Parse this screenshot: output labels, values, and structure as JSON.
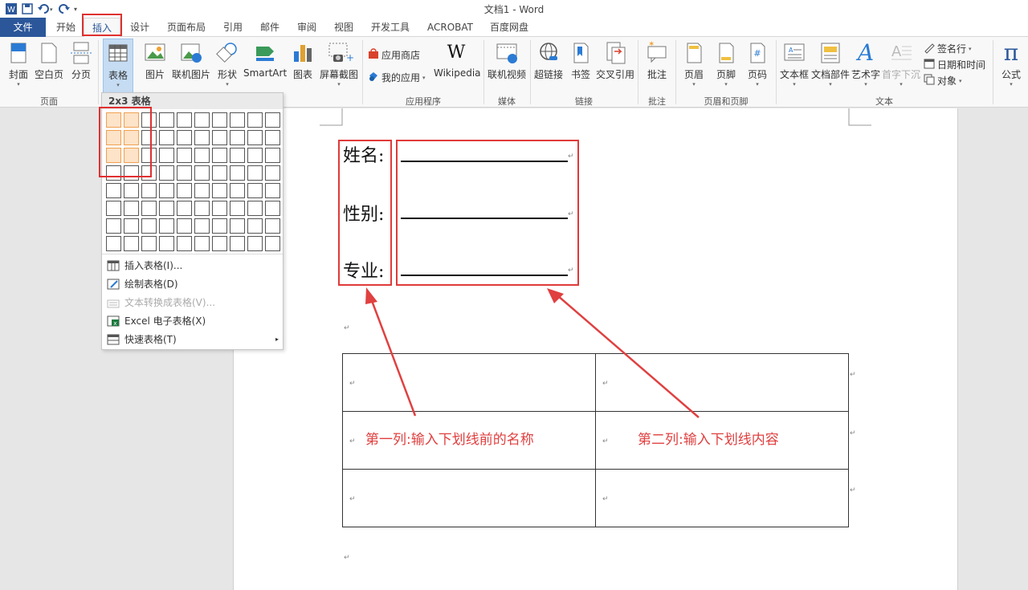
{
  "titlebar": {
    "doc_title": "文档1 - Word"
  },
  "tabs": [
    {
      "label": "文件"
    },
    {
      "label": "开始"
    },
    {
      "label": "插入"
    },
    {
      "label": "设计"
    },
    {
      "label": "页面布局"
    },
    {
      "label": "引用"
    },
    {
      "label": "邮件"
    },
    {
      "label": "审阅"
    },
    {
      "label": "视图"
    },
    {
      "label": "开发工具"
    },
    {
      "label": "ACROBAT"
    },
    {
      "label": "百度网盘"
    }
  ],
  "ribbon": {
    "buttons": {
      "cover": "封面",
      "blank": "空白页",
      "pagebreak": "分页",
      "table": "表格",
      "picture": "图片",
      "online_picture": "联机图片",
      "shapes": "形状",
      "smartart": "SmartArt",
      "chart": "图表",
      "screenshot": "屏幕截图",
      "app_store": "应用商店",
      "my_apps": "我的应用",
      "wikipedia": "Wikipedia",
      "online_video": "联机视频",
      "hyperlink": "超链接",
      "bookmark": "书签",
      "cross_ref": "交叉引用",
      "comment": "批注",
      "header": "页眉",
      "footer": "页脚",
      "page_number": "页码",
      "textbox": "文本框",
      "quick_parts": "文档部件",
      "wordart": "艺术字",
      "dropcap": "首字下沉",
      "signature": "签名行",
      "datetime": "日期和时间",
      "object": "对象",
      "equation": "公式"
    },
    "groups": {
      "pages": "页面",
      "apps": "应用程序",
      "media": "媒体",
      "links": "链接",
      "comments": "批注",
      "header_footer": "页眉和页脚",
      "text": "文本"
    }
  },
  "table_menu": {
    "header": "2x3 表格",
    "rows": 8,
    "cols": 10,
    "sel_rows": 3,
    "sel_cols": 2,
    "items": [
      {
        "label": "插入表格(I)..."
      },
      {
        "label": "绘制表格(D)"
      },
      {
        "label": "文本转换成表格(V)..."
      },
      {
        "label": "Excel 电子表格(X)"
      },
      {
        "label": "快速表格(T)"
      }
    ]
  },
  "document": {
    "labels": [
      "姓名:",
      "性别:",
      "专业:"
    ],
    "note_left": "第一列:输入下划线前的名称",
    "note_right": "第二列:输入下划线内容"
  },
  "colors": {
    "accent": "#2b579a",
    "highlight": "#e03030",
    "annotation": "#e04040"
  }
}
